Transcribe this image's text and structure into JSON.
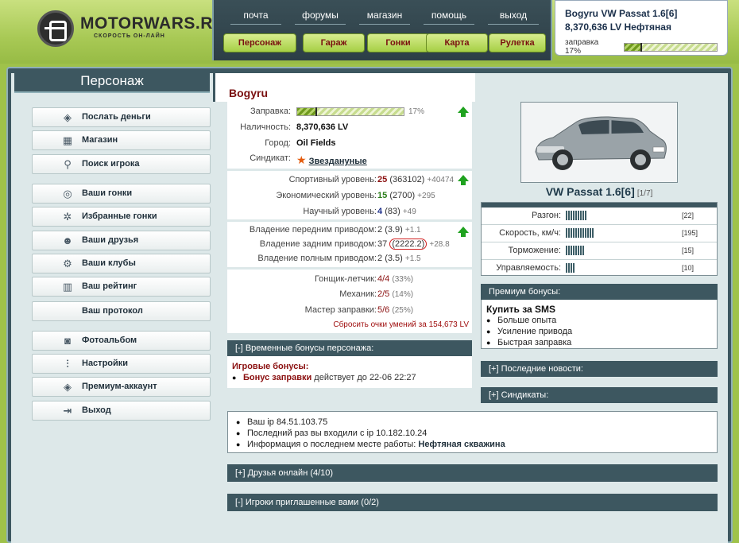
{
  "logo": {
    "text": "MOTORWARS.RU",
    "subtitle": "СКОРОСТЬ ОН-ЛАЙН"
  },
  "nav": {
    "top": [
      "почта",
      "форумы",
      "магазин",
      "помощь",
      "выход"
    ],
    "buttons": [
      "Персонаж",
      "Гараж",
      "Гонки",
      "Карта",
      "Рулетка"
    ]
  },
  "userbox": {
    "line1": "Bogyru VW Passat 1.6[6]",
    "line2": "8,370,636 LV Нефтяная",
    "fuel_label": "заправка 17%",
    "fuel_percent": 17
  },
  "left": {
    "title": "Персонаж",
    "menu": [
      {
        "label": "Послать деньги",
        "icon": "money-icon"
      },
      {
        "label": "Магазин",
        "icon": "shop-icon"
      },
      {
        "label": "Поиск игрока",
        "icon": "search-icon"
      },
      {
        "label": "Ваши гонки",
        "icon": "steering-wheel-icon"
      },
      {
        "label": "Избранные гонки",
        "icon": "favorite-races-icon"
      },
      {
        "label": "Ваши друзья",
        "icon": "friends-icon"
      },
      {
        "label": "Ваши клубы",
        "icon": "clubs-icon"
      },
      {
        "label": "Ваш рейтинг",
        "icon": "rating-icon"
      },
      {
        "label": "Ваш протокол",
        "icon": ""
      },
      {
        "label": "Фотоальбом",
        "icon": "photo-icon"
      },
      {
        "label": "Настройки",
        "icon": "settings-icon"
      },
      {
        "label": "Премиум-аккаунт",
        "icon": "premium-icon"
      },
      {
        "label": "Выход",
        "icon": "exit-icon"
      }
    ]
  },
  "char": {
    "name": "Bogyru",
    "fuel_label": "Заправка:",
    "fuel_percent": 17,
    "fuel_text": "17%",
    "cash_label": "Наличность:",
    "cash": "8,370,636 LV",
    "city_label": "Город:",
    "city": "Oil Fields",
    "syndicate_label": "Синдикат:",
    "syndicate": "Звездануные",
    "sport_label": "Спортивный уровень:",
    "sport_lvl": "25",
    "sport_pts": "(363102)",
    "sport_plus": "+40474",
    "econ_label": "Экономический уровень:",
    "econ_lvl": "15",
    "econ_pts": "(2700)",
    "econ_plus": "+295",
    "sci_label": "Научный уровень:",
    "sci_lvl": "4",
    "sci_pts": "(83)",
    "sci_plus": "+49",
    "fwd_label": "Владение передним приводом:",
    "fwd_val": "2",
    "fwd_pts": "(3.9)",
    "fwd_plus": "+1.1",
    "rwd_label": "Владение задним приводом:",
    "rwd_val": "37",
    "rwd_pts": "(2222.2)",
    "rwd_plus": "+28.8",
    "awd_label": "Владение полным приводом:",
    "awd_val": "2",
    "awd_pts": "(3.5)",
    "awd_plus": "+1.5",
    "pilot_label": "Гонщик-летчик:",
    "pilot_val": "4/4",
    "pilot_pct": "(33%)",
    "mech_label": "Механик:",
    "mech_val": "2/5",
    "mech_pct": "(14%)",
    "fuelm_label": "Мастер заправки:",
    "fuelm_val": "5/6",
    "fuelm_pct": "(25%)",
    "reset_text": "Сбросить очки умений за 154,673 LV"
  },
  "temp_bonus": {
    "header": "[-]  Временные бонусы персонажа:",
    "title": "Игровые бонусы:",
    "item_bold": "Бонус заправки",
    "item_rest": " действует до 22-06 22:27"
  },
  "car": {
    "name": "VW Passat 1.6[6]",
    "count": "[1/7]",
    "stats": [
      {
        "label": "Разгон:",
        "bars": 9,
        "value": "[22]"
      },
      {
        "label": "Скорость, км/ч:",
        "bars": 12,
        "value": "[195]"
      },
      {
        "label": "Торможение:",
        "bars": 8,
        "value": "[15]"
      },
      {
        "label": "Управляемость:",
        "bars": 4,
        "value": "[10]"
      }
    ]
  },
  "premium": {
    "header": "Премиум бонусы:",
    "title": "Купить за SMS",
    "items": [
      "Больше опыта",
      "Усиление привода",
      "Быстрая заправка"
    ]
  },
  "news": {
    "header": "[+]  Последние новости:"
  },
  "syndicates": {
    "header": "[+]  Синдикаты:"
  },
  "ip": {
    "line1": "Ваш ip 84.51.103.75",
    "line2": "Последний раз вы входили с ip 10.182.10.24",
    "line3_a": "Информация о последнем месте работы: ",
    "line3_b": "Нефтяная скважина"
  },
  "friends": {
    "header": "[+]  Друзья онлайн (4/10)"
  },
  "invited": {
    "header": "[-]  Игроки приглашенные вами (0/2)"
  }
}
